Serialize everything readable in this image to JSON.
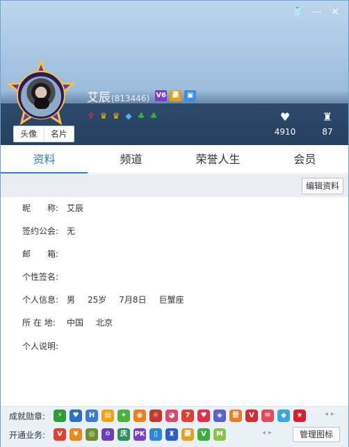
{
  "window": {
    "controls": {
      "skin": "👕",
      "minimize": "—",
      "close": "✕"
    }
  },
  "header": {
    "nickname": "艾辰",
    "uid": "(813446)",
    "tags": [
      {
        "icon": "vip6-icon",
        "text": "V6",
        "color": "#7b3fc4"
      },
      {
        "icon": "hao-icon",
        "text": "豪",
        "color": "#e0a21c"
      },
      {
        "icon": "id-card-icon",
        "text": "▣",
        "color": "#3a8fd8"
      }
    ],
    "medals": [
      {
        "icon": "wings-icon",
        "glyph": "♆",
        "color": "#e33"
      },
      {
        "icon": "crown-icon",
        "glyph": "♛",
        "color": "#f2b50c"
      },
      {
        "icon": "crown-icon",
        "glyph": "♛",
        "color": "#f2b50c"
      },
      {
        "icon": "diamond-icon",
        "glyph": "◆",
        "color": "#4fb3ec"
      },
      {
        "icon": "clover-icon",
        "glyph": "♣",
        "color": "#3cb43c"
      },
      {
        "icon": "clover-icon",
        "glyph": "♣",
        "color": "#3cb43c"
      }
    ],
    "avatar_tabs": [
      "头像",
      "名片"
    ],
    "stats": {
      "likes": {
        "icon": "heart-icon",
        "glyph": "♥",
        "value": "4910"
      },
      "level": {
        "icon": "rank-icon",
        "glyph": "♜",
        "value": "87"
      }
    }
  },
  "tabs": [
    "资料",
    "频道",
    "荣誉人生",
    "会员"
  ],
  "active_tab": 0,
  "edit_button": "编辑资料",
  "profile": {
    "nickname": {
      "label": "昵　　称:",
      "value": "艾辰"
    },
    "guild": {
      "label": "签约公会:",
      "value": "无"
    },
    "email": {
      "label": "邮　　箱:",
      "value": ""
    },
    "signature": {
      "label": "个性签名:",
      "value": ""
    },
    "info": {
      "label": "个人信息:",
      "gender": "男",
      "age": "25岁",
      "birthday": "7月8日",
      "zodiac": "巨蟹座"
    },
    "location": {
      "label": "所 在 地:",
      "country": "中国",
      "city": "北京"
    },
    "description": {
      "label": "个人说明:",
      "value": ""
    }
  },
  "achievements": {
    "label": "成就勋章:",
    "badges": [
      {
        "icon": "bolt-badge-icon",
        "text": "⚡",
        "color": "#2d9c3a"
      },
      {
        "icon": "heart-badge-icon",
        "text": "♥",
        "color": "#2a6fc4"
      },
      {
        "icon": "h-badge-icon",
        "text": "H",
        "color": "#3a7bd5"
      },
      {
        "icon": "photo-badge-icon",
        "text": "▤",
        "color": "#f2a20c"
      },
      {
        "icon": "leaf-badge-icon",
        "text": "✦",
        "color": "#4db23a"
      },
      {
        "icon": "pumpkin-badge-icon",
        "text": "◉",
        "color": "#f07d1a"
      },
      {
        "icon": "sun-badge-icon",
        "text": "☼",
        "color": "#c0392b"
      },
      {
        "icon": "pig-badge-icon",
        "text": "◕",
        "color": "#d64b6a"
      },
      {
        "icon": "seven-badge-icon",
        "text": "7",
        "color": "#e0412f"
      },
      {
        "icon": "love-badge-icon",
        "text": "♥",
        "color": "#e0304a"
      },
      {
        "icon": "gem-badge-icon",
        "text": "◈",
        "color": "#5a5fd1"
      },
      {
        "icon": "gift-badge-icon",
        "text": "卌",
        "color": "#e67e22"
      },
      {
        "icon": "v-badge-icon",
        "text": "V",
        "color": "#d12f2f"
      },
      {
        "icon": "mail-badge-icon",
        "text": "✉",
        "color": "#e24a5a"
      },
      {
        "icon": "diamond-badge-icon",
        "text": "◆",
        "color": "#3aa7e0"
      },
      {
        "icon": "star-badge-icon",
        "text": "★",
        "color": "#d6202f"
      }
    ],
    "pager": "◂▸"
  },
  "services": {
    "label": "开通业务:",
    "badges": [
      {
        "icon": "v-service-icon",
        "text": "V",
        "color": "#e0412f"
      },
      {
        "icon": "yen-service-icon",
        "text": "¥",
        "color": "#e88a1a"
      },
      {
        "icon": "snail-service-icon",
        "text": "◎",
        "color": "#6d8f2f"
      },
      {
        "icon": "star-service-icon",
        "text": "✡",
        "color": "#6d3fb5"
      },
      {
        "icon": "shell-service-icon",
        "text": "庆",
        "color": "#2f8f5a"
      },
      {
        "icon": "pk-service-icon",
        "text": "PK",
        "color": "#7a3fc4"
      },
      {
        "icon": "phone-service-icon",
        "text": "▯",
        "color": "#2e86d8"
      },
      {
        "icon": "castle-service-icon",
        "text": "♜",
        "color": "#2d5fc4"
      },
      {
        "icon": "hao-service-icon",
        "text": "豪",
        "color": "#e0a21c"
      },
      {
        "icon": "v-green-service-icon",
        "text": "V",
        "color": "#3cae3c"
      },
      {
        "icon": "m-service-icon",
        "text": "M",
        "color": "#8bc34a"
      }
    ],
    "pager": "◂▸",
    "manage_button": "管理图标"
  }
}
